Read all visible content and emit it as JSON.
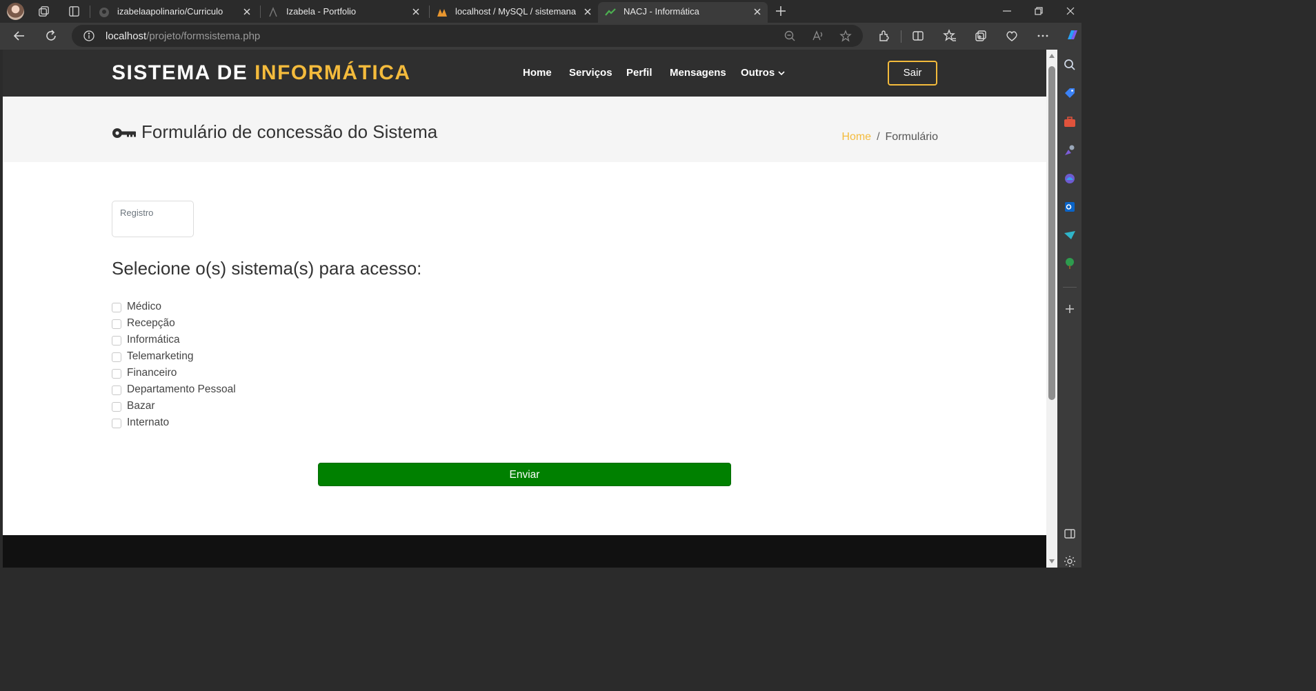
{
  "browser": {
    "tabs": [
      {
        "title": "izabelaapolinario/Curriculo",
        "favicon": "github-icon",
        "active": false
      },
      {
        "title": "Izabela - Portfolio",
        "favicon": "portfolio-icon",
        "active": false
      },
      {
        "title": "localhost / MySQL / sistemanacj",
        "favicon": "phpmyadmin-icon",
        "active": false
      },
      {
        "title": "NACJ - Informática",
        "favicon": "nacj-icon",
        "active": true
      }
    ],
    "url_host": "localhost",
    "url_path": "/projeto/formsistema.php"
  },
  "site": {
    "logo_main": "SISTEMA DE ",
    "logo_accent": "INFORMÁTICA",
    "nav": [
      "Home",
      "Serviços",
      "Perfil",
      "Mensagens",
      "Outros"
    ],
    "logout_label": "Sair"
  },
  "page": {
    "title": "Formulário de concessão do Sistema",
    "breadcrumb_home": "Home",
    "breadcrumb_sep": "/",
    "breadcrumb_current": "Formulário",
    "registro_label": "Registro",
    "section_heading": "Selecione o(s) sistema(s) para acesso:",
    "systems": [
      "Médico",
      "Recepção",
      "Informática",
      "Telemarketing",
      "Financeiro",
      "Departamento Pessoal",
      "Bazar",
      "Internato"
    ],
    "submit_label": "Enviar"
  },
  "colors": {
    "accent": "#f4bb3c",
    "header_bg": "#2f2f2f",
    "submit_bg": "#008000",
    "footer_bg": "#111111"
  }
}
